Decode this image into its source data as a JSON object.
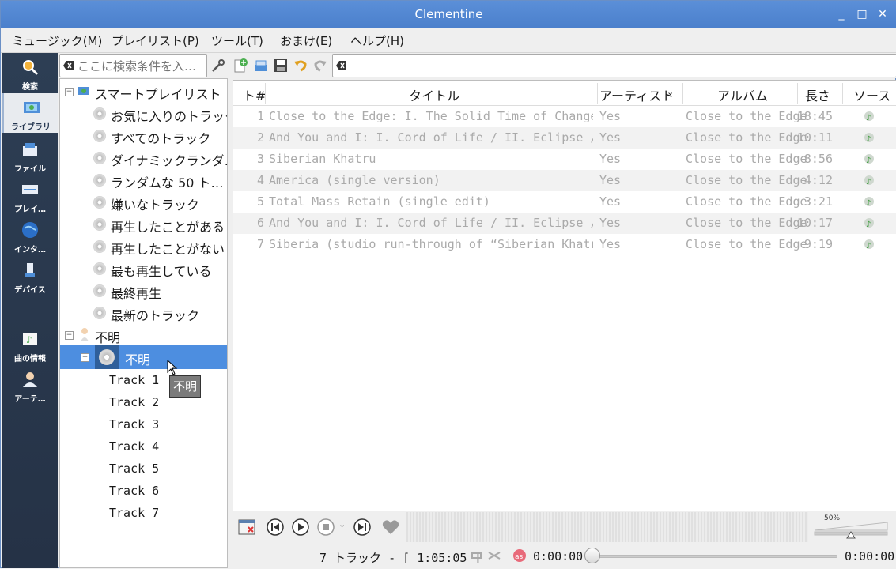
{
  "window": {
    "title": "Clementine",
    "minimize": "_",
    "maximize": "□",
    "close": "✕"
  },
  "menu": [
    {
      "label": "ミュージック(M)"
    },
    {
      "label": "プレイリスト(P)"
    },
    {
      "label": "ツール(T)"
    },
    {
      "label": "おまけ(E)"
    },
    {
      "label": "ヘルプ(H)"
    }
  ],
  "sidebar": [
    {
      "label": "検索",
      "icon": "search-icon"
    },
    {
      "label": "ライブラリ",
      "icon": "library-icon",
      "active": true
    },
    {
      "label": "ファイル",
      "icon": "files-icon"
    },
    {
      "label": "プレイ…",
      "icon": "playlists-icon"
    },
    {
      "label": "インタ…",
      "icon": "internet-icon"
    },
    {
      "label": "デバイス",
      "icon": "devices-icon"
    },
    {
      "label": "曲の情報",
      "icon": "song-info-icon"
    },
    {
      "label": "アーテ…",
      "icon": "artist-info-icon"
    }
  ],
  "search": {
    "placeholder": "ここに検索条件を入…"
  },
  "tree": {
    "smart_playlists_label": "スマートプレイリスト",
    "smart_playlists": [
      "お気に入りのトラック",
      "すべてのトラック",
      "ダイナミックランダ…",
      "ランダムな 50 ト…",
      "嫌いなトラック",
      "再生したことがある",
      "再生したことがない",
      "最も再生している",
      "最終再生",
      "最新のトラック"
    ],
    "artist_label": "不明",
    "album_label": "不明",
    "tracks": [
      "Track 1",
      "Track 2",
      "Track 3",
      "Track 4",
      "Track 5",
      "Track 6",
      "Track 7"
    ],
    "tooltip": "不明"
  },
  "playlist": {
    "columns": {
      "track": "ト#",
      "title": "タイトル",
      "artist": "アーティスト",
      "album": "アルバム",
      "length": "長さ",
      "source": "ソース"
    },
    "rows": [
      {
        "n": "1",
        "title": "Close to the Edge: I. The Solid Time of Change / …",
        "artist": "Yes",
        "album": "Close to the Edge",
        "length": "18:45"
      },
      {
        "n": "2",
        "title": "And You and I: I. Cord of Life / II. Eclipse / II…",
        "artist": "Yes",
        "album": "Close to the Edge",
        "length": "10:11"
      },
      {
        "n": "3",
        "title": "Siberian Khatru",
        "artist": "Yes",
        "album": "Close to the Edge",
        "length": "8:56"
      },
      {
        "n": "4",
        "title": "America (single version)",
        "artist": "Yes",
        "album": "Close to the Edge",
        "length": "4:12"
      },
      {
        "n": "5",
        "title": "Total Mass Retain (single edit)",
        "artist": "Yes",
        "album": "Close to the Edge",
        "length": "3:21"
      },
      {
        "n": "6",
        "title": "And You and I: I. Cord of Life / II. Eclipse / II…",
        "artist": "Yes",
        "album": "Close to the Edge",
        "length": "10:17"
      },
      {
        "n": "7",
        "title": "Siberia (studio run-through of “Siberian Khatru”)",
        "artist": "Yes",
        "album": "Close to the Edge",
        "length": "9:19"
      }
    ]
  },
  "volume": {
    "percent_label": "50%",
    "level": 0.5
  },
  "status": {
    "summary": "7 トラック - [ 1:05:05 ]",
    "elapsed": "0:00:00",
    "total": "0:00:00",
    "position": 0
  },
  "colors": {
    "titlebar": "#4f86d2",
    "selection": "#4d8ee0",
    "sidebar": "#2a3a50"
  }
}
